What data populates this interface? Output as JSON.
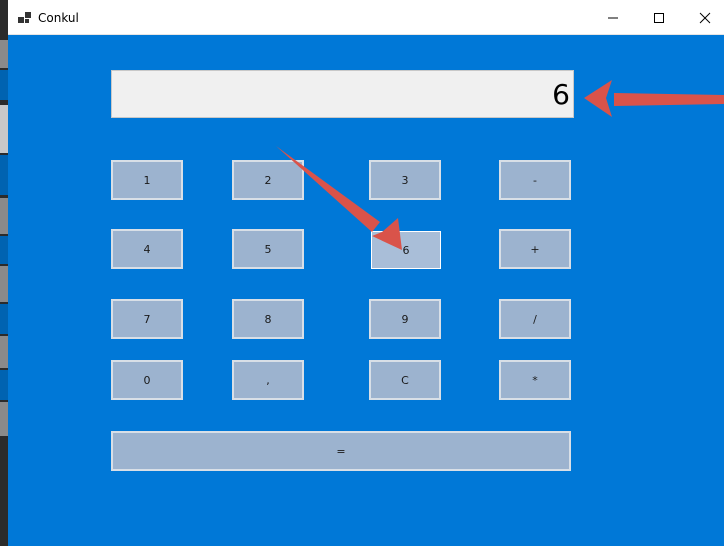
{
  "window": {
    "title": "Conkul",
    "icon": "app-window-icon",
    "controls": [
      "minimize-icon",
      "maximize-icon",
      "close-icon"
    ]
  },
  "calculator": {
    "display_value": "6",
    "keys": {
      "k1": "1",
      "k2": "2",
      "k3": "3",
      "kminus": "-",
      "k4": "4",
      "k5": "5",
      "k6": "6",
      "kplus": "+",
      "k7": "7",
      "k8": "8",
      "k9": "9",
      "kdiv": "/",
      "k0": "0",
      "kcomma": ",",
      "kclear": "C",
      "kmul": "*",
      "kequals": "="
    },
    "pressed_key": "6"
  },
  "colors": {
    "background": "#0078d7",
    "key_fill": "#9cb3cf",
    "display_fill": "#f0f0f0",
    "annotation_arrow": "#d9534a"
  }
}
